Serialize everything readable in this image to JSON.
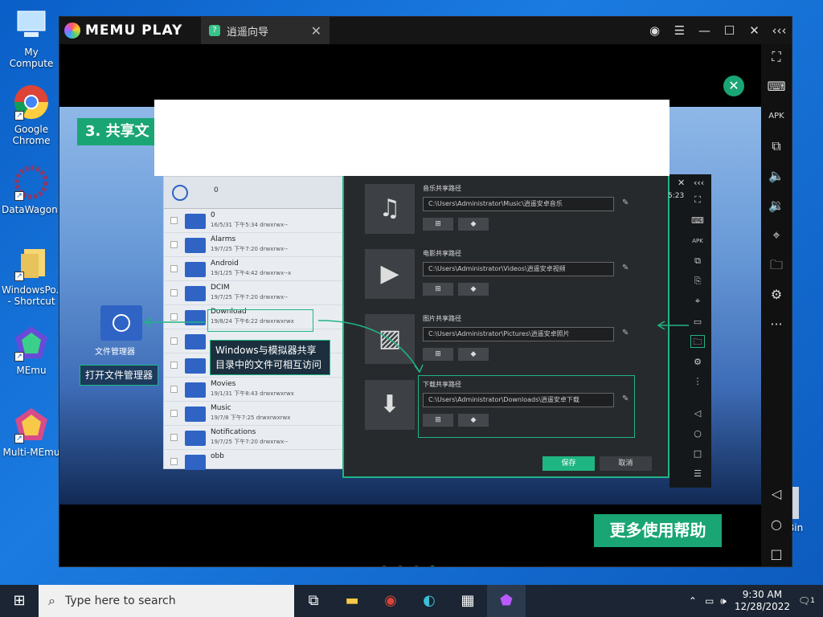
{
  "desktop": {
    "icons": [
      {
        "label": "My Compute",
        "icon": "computer-icon"
      },
      {
        "label": "Google Chrome",
        "icon": "chrome-icon"
      },
      {
        "label": "DataWagon...",
        "icon": "datawagon-icon"
      },
      {
        "label": "WindowsPo... - Shortcut",
        "icon": "folder-icon"
      },
      {
        "label": "MEmu",
        "icon": "memu-icon"
      },
      {
        "label": "Multi-MEmu",
        "icon": "multi-memu-icon"
      }
    ],
    "recycle_label": "Bin"
  },
  "memu": {
    "brand": "MEMU PLAY",
    "tab_title": "逍遥向导",
    "step_title": "3. 共享文",
    "help_button": "更多使用帮助",
    "page_dots": 4,
    "active_dot": 4
  },
  "file_manager": {
    "path": "0",
    "rows": [
      {
        "name": "0",
        "meta": "16/5/31 下午5:34  drwxrwx--"
      },
      {
        "name": "Alarms",
        "meta": "19/7/25 下午7:20  drwxrwx--"
      },
      {
        "name": "Android",
        "meta": "19/1/25 下午4:42  drwxrwx--x"
      },
      {
        "name": "DCIM",
        "meta": "19/7/25 下午7:20  drwxrwx--"
      },
      {
        "name": "Download",
        "meta": "19/8/24 下午6:22  drwxrwxrwx"
      },
      {
        "name": "",
        "meta": ""
      },
      {
        "name": "",
        "meta": ""
      },
      {
        "name": "Movies",
        "meta": "19/1/31 下午8:43  drwxrwxrwx"
      },
      {
        "name": "Music",
        "meta": "19/7/8 下午7:25  drwxrwxrwx"
      },
      {
        "name": "Notifications",
        "meta": "19/7/25 下午7:20  drwxrwx--"
      },
      {
        "name": "obb",
        "meta": ""
      }
    ]
  },
  "callouts": {
    "file_manager_label": "文件管理器",
    "open_file_manager": "打开文件管理器",
    "note": "Windows与模拟器共享目录中的文件可相互访问"
  },
  "share_dialog": {
    "sections": [
      {
        "label": "音乐共享路径",
        "path": "C:\\Users\\Administrator\\Music\\逍遥安卓音乐",
        "thumb": "music-note-icon"
      },
      {
        "label": "电影共享路径",
        "path": "C:\\Users\\Administrator\\Videos\\逍遥安卓视频",
        "thumb": "film-icon"
      },
      {
        "label": "图片共享路径",
        "path": "C:\\Users\\Administrator\\Pictures\\逍遥安卓照片",
        "thumb": "image-icon"
      },
      {
        "label": "下载共享路径",
        "path": "C:\\Users\\Administrator\\Downloads\\逍遥安卓下载",
        "thumb": "download-folder-icon"
      }
    ],
    "save": "保存",
    "cancel": "取消"
  },
  "inner_time": "5:23",
  "taskbar": {
    "search_placeholder": "Type here to search",
    "time": "9:30 AM",
    "date": "12/28/2022",
    "notification_count": "1"
  },
  "colors": {
    "accent": "#1aa574",
    "desktop": "#0a5fc7",
    "taskbar": "#1b2533"
  }
}
